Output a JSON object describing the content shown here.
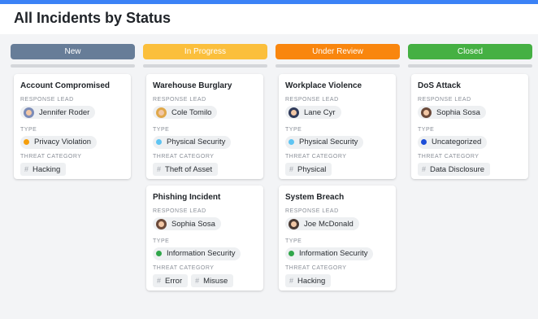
{
  "page": {
    "title": "All Incidents by Status",
    "accent": "#3b82f6"
  },
  "columns": [
    {
      "label": "New",
      "color": "#677d98"
    },
    {
      "label": "In Progress",
      "color": "#fbbf3c"
    },
    {
      "label": "Under Review",
      "color": "#f9860e"
    },
    {
      "label": "Closed",
      "color": "#45b043"
    }
  ],
  "field_labels": {
    "lead": "RESPONSE LEAD",
    "type": "TYPE",
    "category": "THREAT CATEGORY"
  },
  "type_colors": {
    "Privacy Violation": "#f59e0b",
    "Physical Security": "#5ec4f2",
    "Information Security": "#30a64a",
    "Uncategorized": "#1d4ed8"
  },
  "cards": {
    "account_compromised": {
      "title": "Account Compromised",
      "lead": "Jennifer Roder",
      "type": "Privacy Violation",
      "categories": [
        "Hacking"
      ]
    },
    "warehouse_burglary": {
      "title": "Warehouse Burglary",
      "lead": "Cole Tomilo",
      "type": "Physical Security",
      "categories": [
        "Theft of Asset"
      ]
    },
    "phishing_incident": {
      "title": "Phishing Incident",
      "lead": "Sophia Sosa",
      "type": "Information Security",
      "categories": [
        "Error",
        "Misuse"
      ]
    },
    "workplace_violence": {
      "title": "Workplace Violence",
      "lead": "Lane Cyr",
      "type": "Physical Security",
      "categories": [
        "Physical"
      ]
    },
    "system_breach": {
      "title": "System Breach",
      "lead": "Joe McDonald",
      "type": "Information Security",
      "categories": [
        "Hacking"
      ]
    },
    "dos_attack": {
      "title": "DoS Attack",
      "lead": "Sophia Sosa",
      "type": "Uncategorized",
      "categories": [
        "Data Disclosure"
      ]
    }
  }
}
